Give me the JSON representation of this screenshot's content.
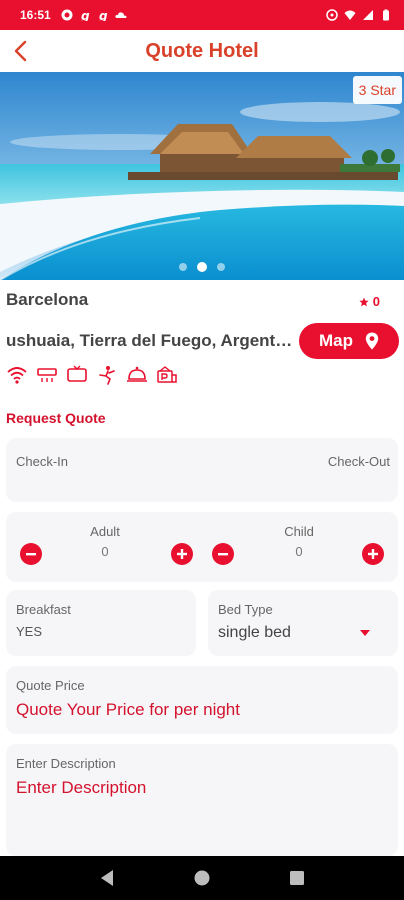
{
  "status_bar": {
    "time": "16:51"
  },
  "header": {
    "title": "Quote Hotel"
  },
  "hero": {
    "badge": "3 Star",
    "active_slide": 2,
    "total_slides": 3
  },
  "hotel": {
    "city": "Barcelona",
    "rating": "0",
    "address": "ushuaia, Tierra del Fuego, Argentina",
    "map_label": "Map"
  },
  "amenities": [
    "wifi-icon",
    "air-conditioner-icon",
    "tv-icon",
    "gym-icon",
    "restaurant-icon",
    "parking-icon"
  ],
  "request": {
    "section_title": "Request Quote",
    "check_in_label": "Check-In",
    "check_out_label": "Check-Out",
    "adult_label": "Adult",
    "adult_value": "0",
    "child_label": "Child",
    "child_value": "0",
    "breakfast_label": "Breakfast",
    "breakfast_value": "YES",
    "bed_type_label": "Bed Type",
    "bed_type_value": "single bed",
    "quote_price_label": "Quote Price",
    "quote_price_placeholder": "Quote Your Price for per night",
    "description_label": "Enter Description",
    "description_placeholder": "Enter Description"
  },
  "colors": {
    "accent": "#e8102e",
    "title": "#d9412a"
  }
}
